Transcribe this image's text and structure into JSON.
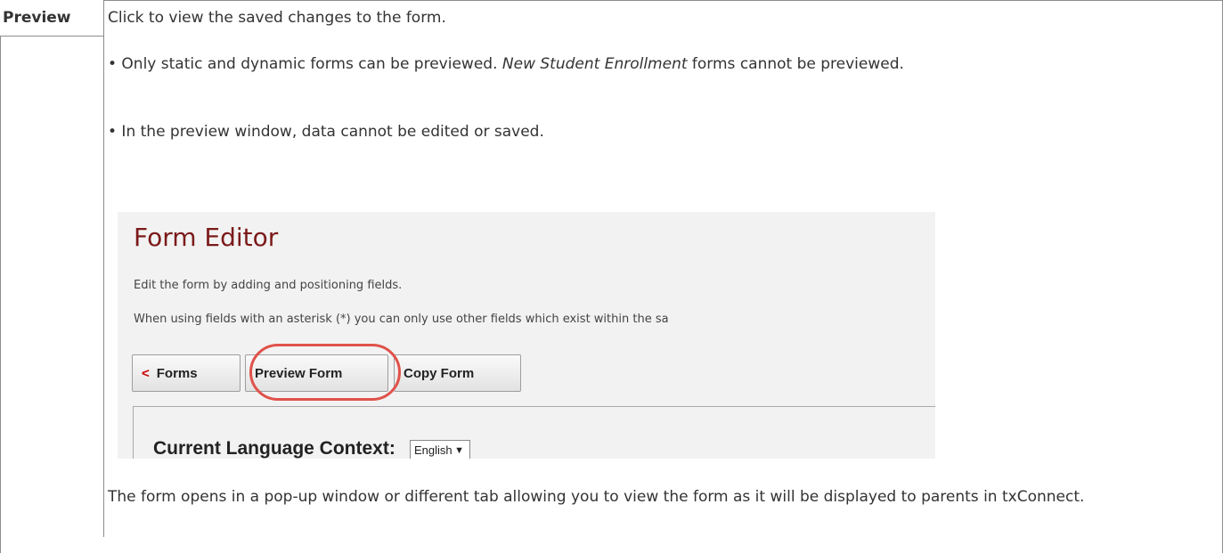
{
  "row": {
    "label": "Preview",
    "line1": "Click to view the saved changes to the form.",
    "line2_prefix": "• Only static and dynamic forms can be previewed. ",
    "line2_italic": "New Student Enrollment",
    "line2_suffix": " forms cannot be previewed.",
    "line3": "• In the preview window, data cannot be edited or saved.",
    "line4": "The form opens in a pop-up window or different tab allowing you to view the form as it will be displayed to parents in txConnect."
  },
  "screenshot": {
    "title": "Form Editor",
    "desc1": "Edit the form by adding and positioning fields.",
    "desc2": "When using fields with an asterisk (*) you can only use other fields which exist within the sa",
    "btn_forms_chevron": "<",
    "btn_forms": "Forms",
    "btn_preview": "Preview Form",
    "btn_copy": "Copy Form",
    "context_label": "Current Language Context:",
    "context_value": "English",
    "highlight_color": "#e0524a",
    "title_color": "#7b1a1a"
  }
}
